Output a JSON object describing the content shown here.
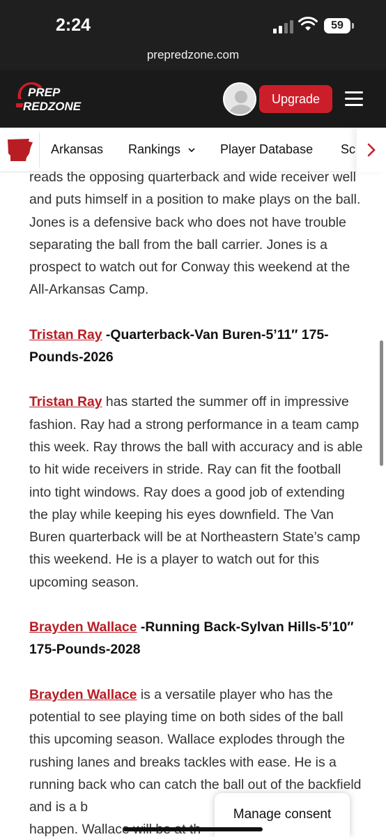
{
  "status_bar": {
    "time": "2:24",
    "battery": "59"
  },
  "browser": {
    "url": "prepredzone.com"
  },
  "header": {
    "logo_top": "PREP",
    "logo_bottom": "REDZONE",
    "upgrade_label": "Upgrade",
    "brand_color": "#cc1e2a"
  },
  "nav": {
    "state_icon": "arkansas-state-icon",
    "items": [
      "Arkansas",
      "Rankings",
      "Player Database",
      "Sc"
    ]
  },
  "article": {
    "intro": "reads the opposing quarterback and wide receiver well and puts himself in a position to make plays on the ball. Jones is a defensive back who does not have trouble separating the ball from the ball carrier. Jones is a prospect to watch out for Conway this weekend at the All-Arkansas Camp.",
    "players": [
      {
        "name": "Tristan Ray",
        "heading_rest": " -Quarterback-Van Buren-5’11″ 175-Pounds-2026",
        "body": " has started the summer off in impressive fashion. Ray had a strong performance in a team camp this week. Ray throws the ball with accuracy and is able to hit wide receivers in stride. Ray can fit the football into tight windows. Ray does a good job of extending the play while keeping his eyes downfield. The Van Buren quarterback will be at Northeastern State’s camp this weekend. He is a player to watch out for this upcoming season."
      },
      {
        "name": "Brayden Wallace",
        "heading_rest": " -Running Back-Sylvan Hills-5’10″ 175-Pounds-2028",
        "body": " is a versatile player who has the potential to see playing time on both sides of the ball this upcoming season. Wallace explodes through the rushing lanes and breaks tackles with ease. He is a running back who can catch the ball out of the backfield and is a b",
        "body_tail": "happen. Wallace will be at th"
      }
    ]
  },
  "consent": {
    "label": "Manage consent"
  }
}
